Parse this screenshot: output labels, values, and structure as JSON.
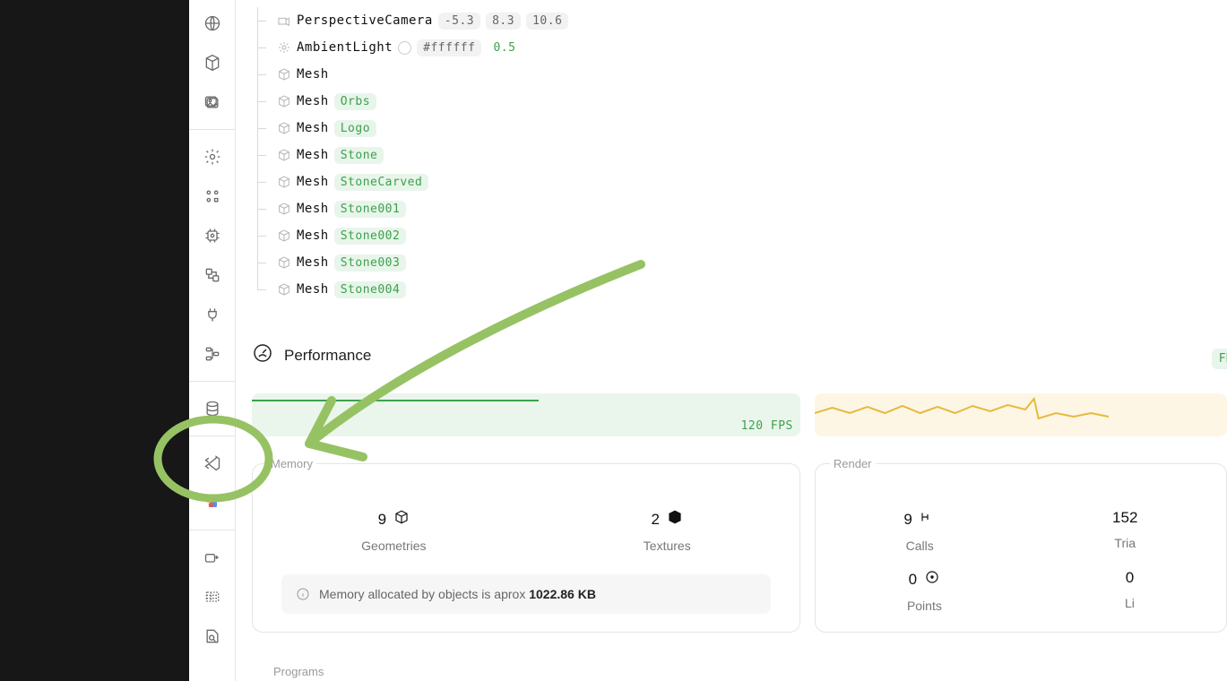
{
  "sidebar_icons": [
    "web",
    "box3d",
    "images",
    "gear",
    "toggles",
    "chip",
    "transform",
    "plug",
    "flow",
    "database",
    "vscode",
    "colorful",
    "share",
    "table",
    "search-doc"
  ],
  "tree": {
    "items": [
      {
        "icon": "camera",
        "name": "PerspectiveCamera",
        "badges": [
          {
            "text": "-5.3"
          },
          {
            "text": "8.3"
          },
          {
            "text": "10.6"
          }
        ]
      },
      {
        "icon": "light",
        "name": "AmbientLight",
        "swatch": "#ffffff",
        "badges": [
          {
            "text": "#ffffff"
          },
          {
            "text": "0.5",
            "green": true
          }
        ]
      },
      {
        "icon": "cube",
        "name": "Mesh"
      },
      {
        "icon": "cube",
        "name": "Mesh",
        "badges": [
          {
            "text": "Orbs",
            "greenbg": true
          }
        ]
      },
      {
        "icon": "cube",
        "name": "Mesh",
        "badges": [
          {
            "text": "Logo",
            "greenbg": true
          }
        ]
      },
      {
        "icon": "cube",
        "name": "Mesh",
        "badges": [
          {
            "text": "Stone",
            "greenbg": true
          }
        ]
      },
      {
        "icon": "cube",
        "name": "Mesh",
        "badges": [
          {
            "text": "StoneCarved",
            "greenbg": true
          }
        ]
      },
      {
        "icon": "cube",
        "name": "Mesh",
        "badges": [
          {
            "text": "Stone001",
            "greenbg": true
          }
        ]
      },
      {
        "icon": "cube",
        "name": "Mesh",
        "badges": [
          {
            "text": "Stone002",
            "greenbg": true
          }
        ]
      },
      {
        "icon": "cube",
        "name": "Mesh",
        "badges": [
          {
            "text": "Stone003",
            "greenbg": true
          }
        ]
      },
      {
        "icon": "cube",
        "name": "Mesh",
        "badges": [
          {
            "text": "Stone004",
            "greenbg": true
          }
        ],
        "last": true
      }
    ]
  },
  "performance": {
    "title": "Performance",
    "fps_label": "120 FPS",
    "top_right_pill": "FPS:",
    "memory": {
      "label": "Memory",
      "geometries": {
        "value": "9",
        "label": "Geometries"
      },
      "textures": {
        "value": "2",
        "label": "Textures"
      },
      "note_prefix": "Memory allocated by objects is aprox ",
      "note_value": "1022.86 KB"
    },
    "render": {
      "label": "Render",
      "calls": {
        "value": "9",
        "label": "Calls"
      },
      "tri": {
        "value": "152",
        "label": "Tria"
      },
      "points": {
        "value": "0",
        "label": "Points"
      },
      "lines": {
        "value": "0",
        "label": "Li"
      }
    },
    "programs_label": "Programs"
  }
}
